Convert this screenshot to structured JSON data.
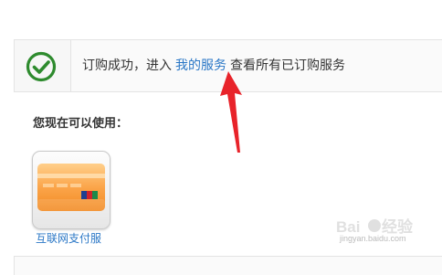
{
  "notice": {
    "text_before": "订购成功，进入",
    "link": "我的服务",
    "text_after": "查看所有已订购服务",
    "icon": "check-circle-icon",
    "icon_color": "#2e8b2e",
    "link_color": "#2a77c6"
  },
  "annotation": {
    "icon": "red-arrow-icon",
    "color": "#e8232a"
  },
  "available": {
    "heading": "您现在可以使用：",
    "services": [
      {
        "label": "互联网支付服",
        "icon": "credit-card-icon"
      }
    ]
  },
  "watermark": {
    "url": "jingyan.baidu.com"
  }
}
